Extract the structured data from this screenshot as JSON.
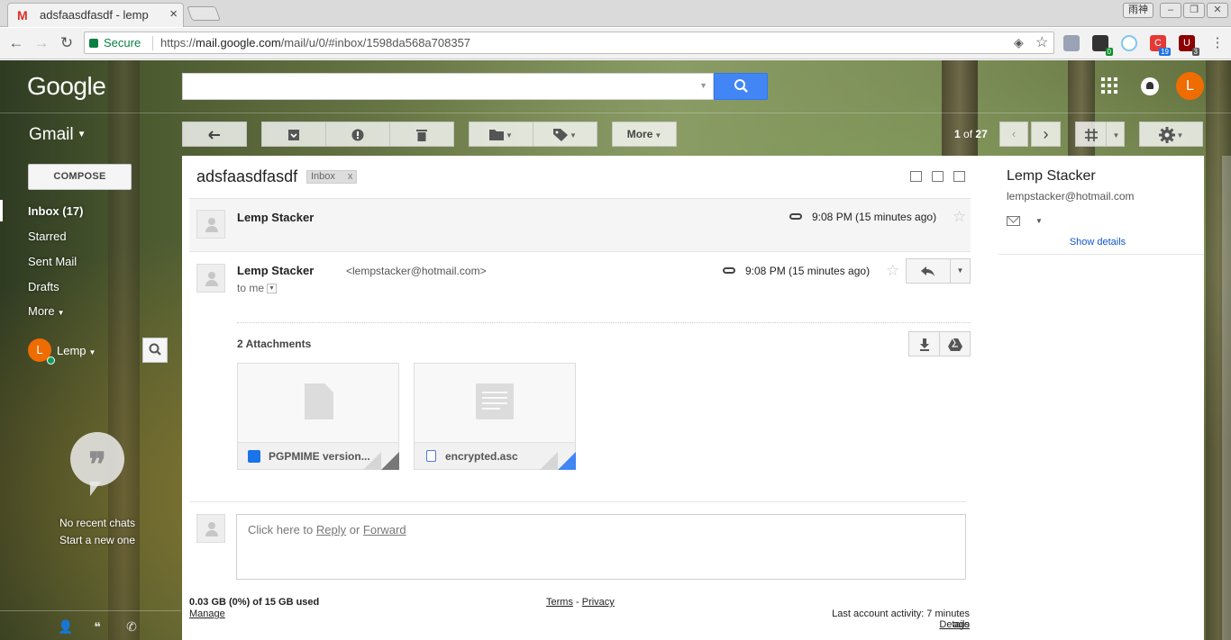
{
  "browser": {
    "tab_title": "adsfaasdfasdf - lemp",
    "tab_favicon": "M",
    "profile_chip": "雨神",
    "secure_label": "Secure",
    "url_scheme": "https://",
    "url_host": "mail.google.com",
    "url_path": "/mail/u/0/#inbox/1598da568a708357",
    "extension_badges": [
      "0",
      "19",
      "3"
    ],
    "extension_letters": [
      "C",
      "U"
    ]
  },
  "header": {
    "logo": "Google",
    "avatar_letter": "L",
    "search_value": "",
    "search_placeholder": ""
  },
  "gmail": {
    "label": "Gmail"
  },
  "toolbar": {
    "more_label": "More",
    "page_current": "1",
    "page_of": "of",
    "page_total": "27"
  },
  "nav": {
    "compose": "COMPOSE",
    "items": [
      {
        "label": "Inbox (17)"
      },
      {
        "label": "Starred"
      },
      {
        "label": "Sent Mail"
      },
      {
        "label": "Drafts"
      },
      {
        "label": "More"
      }
    ]
  },
  "hangouts": {
    "avatar_letter": "L",
    "user_name": "Lemp",
    "no_chats": "No recent chats",
    "start_new": "Start a new one"
  },
  "thread": {
    "subject": "adsfaasdfasdf",
    "label": "Inbox",
    "label_remove": "x",
    "messages": [
      {
        "sender": "Lemp Stacker",
        "time": "9:08 PM (15 minutes ago)"
      },
      {
        "sender": "Lemp Stacker",
        "email": "<lempstacker@hotmail.com>",
        "time": "9:08 PM (15 minutes ago)",
        "to": "to me"
      }
    ],
    "attachments_title": "2 Attachments",
    "attachments": [
      {
        "name": "PGPMIME version..."
      },
      {
        "name": "encrypted.asc"
      }
    ],
    "reply_prompt_prefix": "Click here to ",
    "reply_word": "Reply",
    "reply_or": " or ",
    "forward_word": "Forward"
  },
  "footer": {
    "quota": "0.03 GB (0%) of 15 GB used",
    "manage": "Manage",
    "terms": "Terms",
    "dash": " - ",
    "privacy": "Privacy",
    "activity": "Last account activity: 7 minutes ago",
    "details": "Details"
  },
  "contact": {
    "name": "Lemp Stacker",
    "email": "lempstacker@hotmail.com",
    "show_details": "Show details"
  },
  "colors": {
    "accent": "#4285f4",
    "avatar": "#ef6c00",
    "online": "#0f9d58",
    "secure": "#0b8043",
    "link": "#1155cc"
  }
}
